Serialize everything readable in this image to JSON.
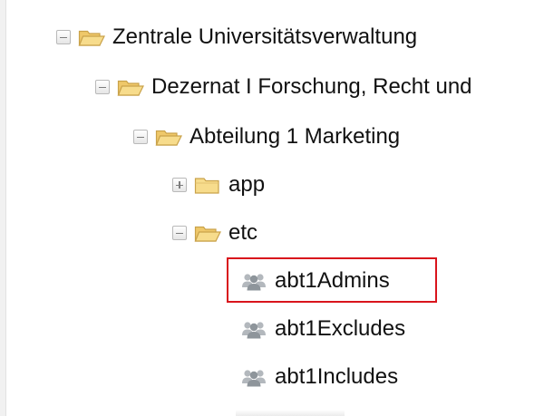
{
  "tree": {
    "nodes": [
      {
        "label": "Zentrale Universitätsverwaltung",
        "state": "expanded",
        "icon": "folder-open-icon"
      },
      {
        "label": "Dezernat I Forschung, Recht und",
        "state": "expanded",
        "icon": "folder-open-icon"
      },
      {
        "label": "Abteilung 1 Marketing",
        "state": "expanded",
        "icon": "folder-open-icon"
      },
      {
        "label": "app",
        "state": "collapsed",
        "icon": "folder-closed-icon"
      },
      {
        "label": "etc",
        "state": "expanded",
        "icon": "folder-open-icon"
      },
      {
        "label": "abt1Admins",
        "state": "leaf",
        "icon": "user-group-icon",
        "highlighted": true
      },
      {
        "label": "abt1Excludes",
        "state": "leaf",
        "icon": "user-group-icon"
      },
      {
        "label": "abt1Includes",
        "state": "leaf",
        "icon": "user-group-icon"
      }
    ]
  },
  "colors": {
    "highlight_border": "#d9141c",
    "folder_fill": "#f7dc8c",
    "folder_stroke": "#c9a24a",
    "group_icon": "#9aa0a6",
    "text": "#111111"
  }
}
